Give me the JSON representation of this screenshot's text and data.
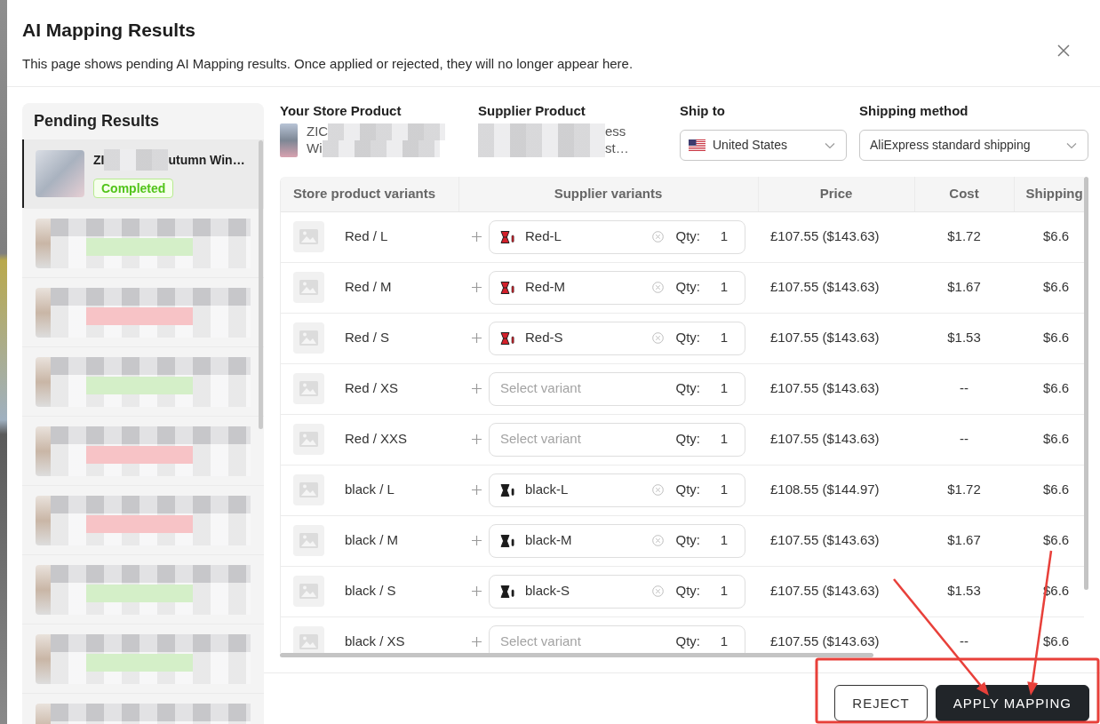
{
  "dialog": {
    "title": "AI Mapping Results",
    "subtitle": "This page shows pending AI Mapping results. Once applied or rejected, they will no longer appear here."
  },
  "pending_results": {
    "heading": "Pending Results",
    "items": [
      {
        "selected": true,
        "title_start": "ZI",
        "title_end": "utumn Win…",
        "status": {
          "label": "Completed",
          "kind": "success"
        }
      },
      {
        "selected": false,
        "color": "#d4efc8"
      },
      {
        "selected": false,
        "color": "#f7c3c6"
      },
      {
        "selected": false,
        "color": "#d4efc8"
      },
      {
        "selected": false,
        "color": "#f7c3c6"
      },
      {
        "selected": false,
        "color": "#f7c3c6"
      },
      {
        "selected": false,
        "color": "#d4efc8"
      },
      {
        "selected": false,
        "color": "#d4efc8"
      },
      {
        "selected": false
      }
    ]
  },
  "store_product": {
    "label": "Your Store Product",
    "name_lines": [
      {
        "visible_start": "ZIC"
      },
      {
        "visible_start": "Wi"
      }
    ]
  },
  "supplier_product": {
    "label": "Supplier Product",
    "name_lines": [
      {
        "visible_end": "ess"
      },
      {
        "visible_end": "st…"
      }
    ]
  },
  "ship_to": {
    "label": "Ship to",
    "value": "United States"
  },
  "shipping_method": {
    "label": "Shipping method",
    "value": "AliExpress standard shipping"
  },
  "table": {
    "columns": [
      "Store product variants",
      "Supplier variants",
      "Price",
      "Cost",
      "Shipping"
    ],
    "rows": [
      {
        "store_variant": "Red / L",
        "supplier_variant": {
          "value": "Red-L",
          "color": "#d3202a"
        },
        "qty_label": "Qty:",
        "qty": "1",
        "price": "£107.55 ($143.63)",
        "cost": "$1.72",
        "shipping": "$6.6"
      },
      {
        "store_variant": "Red / M",
        "supplier_variant": {
          "value": "Red-M",
          "color": "#d3202a"
        },
        "qty_label": "Qty:",
        "qty": "1",
        "price": "£107.55 ($143.63)",
        "cost": "$1.67",
        "shipping": "$6.6"
      },
      {
        "store_variant": "Red / S",
        "supplier_variant": {
          "value": "Red-S",
          "color": "#d3202a"
        },
        "qty_label": "Qty:",
        "qty": "1",
        "price": "£107.55 ($143.63)",
        "cost": "$1.53",
        "shipping": "$6.6"
      },
      {
        "store_variant": "Red / XS",
        "supplier_variant": {
          "placeholder": "Select variant"
        },
        "qty_label": "Qty:",
        "qty": "1",
        "price": "£107.55 ($143.63)",
        "cost": "--",
        "shipping": "$6.6"
      },
      {
        "store_variant": "Red / XXS",
        "supplier_variant": {
          "placeholder": "Select variant"
        },
        "qty_label": "Qty:",
        "qty": "1",
        "price": "£107.55 ($143.63)",
        "cost": "--",
        "shipping": "$6.6"
      },
      {
        "store_variant": "black / L",
        "supplier_variant": {
          "value": "black-L",
          "color": "#1b1b1b"
        },
        "qty_label": "Qty:",
        "qty": "1",
        "price": "£108.55 ($144.97)",
        "cost": "$1.72",
        "shipping": "$6.6"
      },
      {
        "store_variant": "black / M",
        "supplier_variant": {
          "value": "black-M",
          "color": "#1b1b1b"
        },
        "qty_label": "Qty:",
        "qty": "1",
        "price": "£107.55 ($143.63)",
        "cost": "$1.67",
        "shipping": "$6.6"
      },
      {
        "store_variant": "black / S",
        "supplier_variant": {
          "value": "black-S",
          "color": "#1b1b1b"
        },
        "qty_label": "Qty:",
        "qty": "1",
        "price": "£107.55 ($143.63)",
        "cost": "$1.53",
        "shipping": "$6.6"
      },
      {
        "store_variant": "black / XS",
        "supplier_variant": {
          "placeholder": "Select variant"
        },
        "qty_label": "Qty:",
        "qty": "1",
        "price": "£107.55 ($143.63)",
        "cost": "--",
        "shipping": "$6.6"
      }
    ]
  },
  "buttons": [
    {
      "label": "REJECT",
      "kind": "outline"
    },
    {
      "label": "APPLY MAPPING",
      "kind": "primary"
    }
  ]
}
